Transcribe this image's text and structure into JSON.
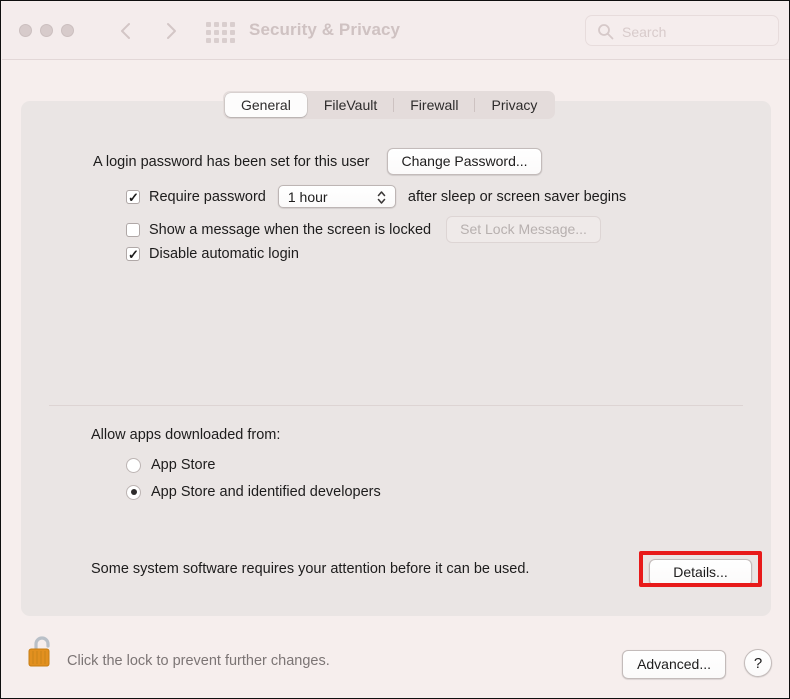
{
  "window": {
    "title": "Security & Privacy",
    "traffic_lights": [
      "close",
      "minimize",
      "zoom"
    ]
  },
  "toolbar": {
    "back_icon": "chevron-left-icon",
    "forward_icon": "chevron-right-icon",
    "grid_icon": "show-all-grid-icon",
    "search": {
      "placeholder": "Search",
      "value": "",
      "icon": "search-icon"
    }
  },
  "tabs": [
    {
      "label": "General",
      "selected": true
    },
    {
      "label": "FileVault",
      "selected": false
    },
    {
      "label": "Firewall",
      "selected": false
    },
    {
      "label": "Privacy",
      "selected": false
    }
  ],
  "general": {
    "password_status": "A login password has been set for this user",
    "change_password_button": "Change Password...",
    "require_password": {
      "label": "Require password",
      "checked": true,
      "delay_value": "1 hour",
      "suffix": "after sleep or screen saver begins"
    },
    "show_message": {
      "label": "Show a message when the screen is locked",
      "checked": false,
      "button": "Set Lock Message...",
      "button_disabled": true
    },
    "disable_auto_login": {
      "label": "Disable automatic login",
      "checked": true
    },
    "allow_apps": {
      "heading": "Allow apps downloaded from:",
      "options": [
        {
          "label": "App Store",
          "selected": false
        },
        {
          "label": "App Store and identified developers",
          "selected": true
        }
      ]
    },
    "attention": {
      "message": "Some system software requires your attention before it can be used.",
      "button": "Details...",
      "highlight_color": "#e81a1a"
    }
  },
  "footer": {
    "lock_icon": "unlocked-padlock-icon",
    "lock_text": "Click the lock to prevent further changes.",
    "advanced_button": "Advanced...",
    "help_button": "?"
  }
}
